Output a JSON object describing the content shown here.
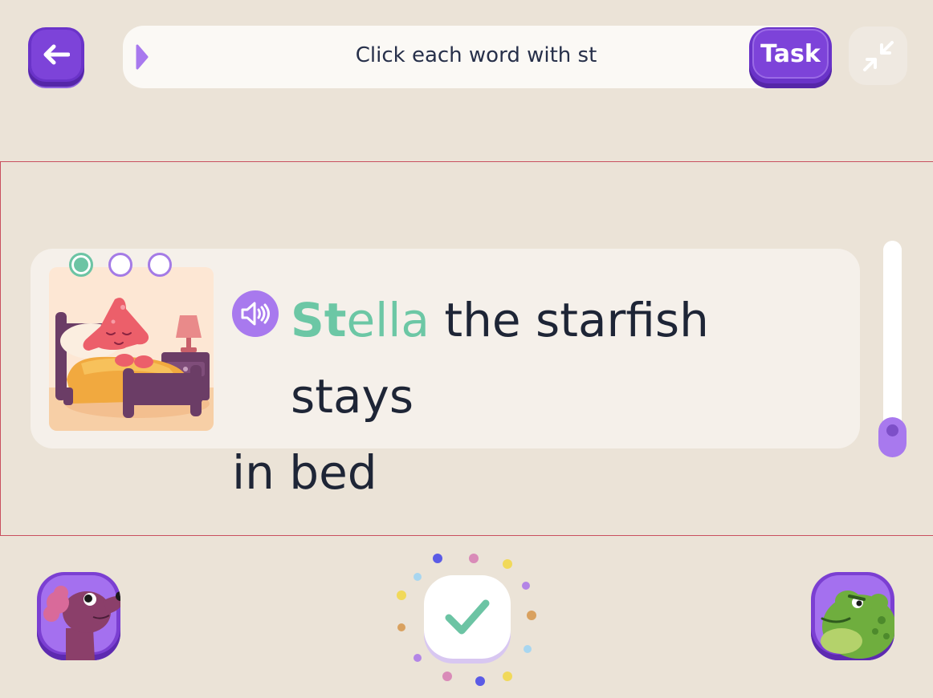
{
  "header": {
    "back_icon": "arrow-left-icon",
    "instruction": "Click each word with st",
    "task_label": "Task",
    "collapse_icon": "collapse-arrows-icon"
  },
  "exercise": {
    "progress": {
      "total": 3,
      "completed": 1
    },
    "speaker_icon": "speaker-icon",
    "highlight_word_prefix": "St",
    "highlight_word_rest": "ella",
    "line1_rest": " the starfish stays",
    "line2": "in bed",
    "illustration": "starfish-sleeping-in-bed"
  },
  "footer": {
    "left_avatar": "dog-avatar",
    "check_icon": "checkmark-icon",
    "right_avatar": "frog-avatar"
  },
  "colors": {
    "background": "#ebe3d7",
    "accent": "#7d43d9",
    "highlight": "#6cc7a5"
  }
}
